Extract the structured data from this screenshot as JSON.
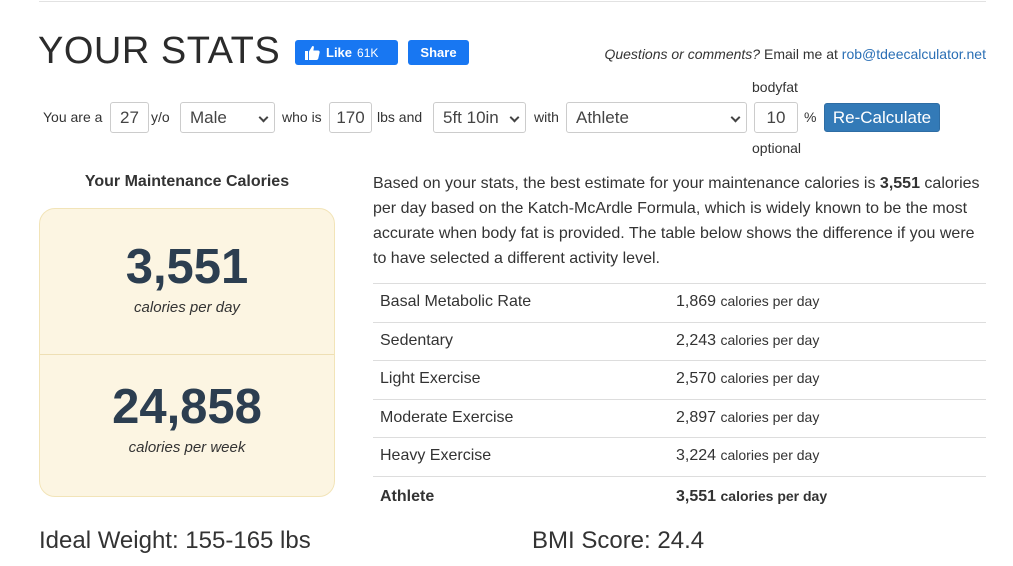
{
  "header": {
    "title": "YOUR STATS",
    "fb_like_label": "Like",
    "fb_like_count": "61K",
    "fb_share_label": "Share",
    "contact_question": "Questions or comments?",
    "contact_prefix": " Email me at ",
    "contact_email": "rob@tdeecalculator.net"
  },
  "form": {
    "you_are_a": "You are a",
    "age": "27",
    "yo": "y/o",
    "gender": "Male",
    "who_is": "who is",
    "weight": "170",
    "lbs_and": "lbs and",
    "height": "5ft 10in",
    "with": "with",
    "activity": "Athlete",
    "bodyfat_label": "bodyfat",
    "bodyfat": "10",
    "percent": "%",
    "optional_label": "optional",
    "recalc_label": "Re-Calculate"
  },
  "maintenance": {
    "heading": "Your Maintenance Calories",
    "daily_value": "3,551",
    "daily_label": "calories per day",
    "weekly_value": "24,858",
    "weekly_label": "calories per week"
  },
  "description": {
    "part1": "Based on your stats, the best estimate for your maintenance calories is ",
    "bold_value": "3,551",
    "part2": " calories per day based on the Katch-McArdle Formula, which is widely known to be the most accurate when body fat is provided. The table below shows the difference if you were to have selected a different activity level."
  },
  "activity_table": {
    "unit": "calories per day",
    "rows": [
      {
        "name": "Basal Metabolic Rate",
        "value": "1,869"
      },
      {
        "name": "Sedentary",
        "value": "2,243"
      },
      {
        "name": "Light Exercise",
        "value": "2,570"
      },
      {
        "name": "Moderate Exercise",
        "value": "2,897"
      },
      {
        "name": "Heavy Exercise",
        "value": "3,224"
      },
      {
        "name": "Athlete",
        "value": "3,551"
      }
    ]
  },
  "footer": {
    "ideal_weight": "Ideal Weight: 155-165 lbs",
    "bmi": "BMI Score: 24.4"
  },
  "colors": {
    "facebook_blue": "#1877f2",
    "button_blue": "#337ab7",
    "link_blue": "#2a6fb5",
    "box_bg": "#fcf5e2",
    "number_dark": "#2c3e50"
  },
  "icons": {
    "fb_like": "thumbs-up-icon",
    "select_arrow": "chevron-down-icon"
  }
}
